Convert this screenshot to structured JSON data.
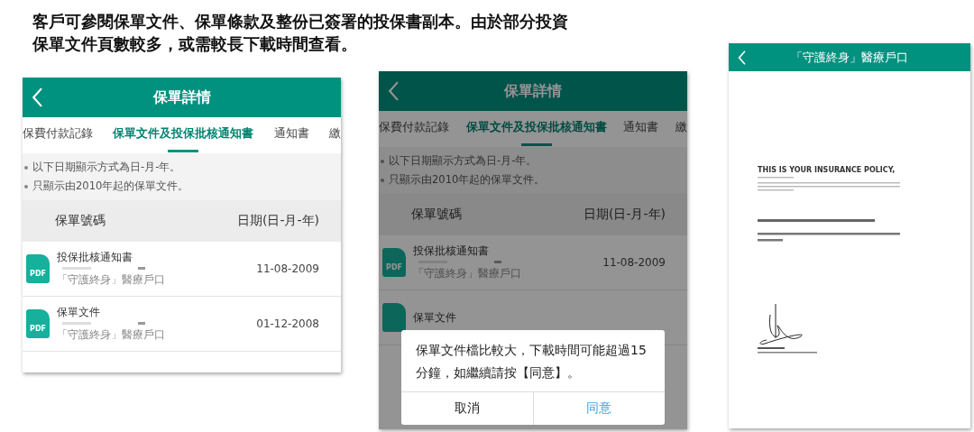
{
  "caption": [
    "客戶可參閱保單文件、保單條款及整份已簽署的投保書副本。由於部分投資",
    "保單文件頁數較多，或需較長下載時間查看。"
  ],
  "screens": [
    {
      "kind": "list",
      "dimmed": false,
      "title": "保單詳情",
      "tabs": [
        {
          "label": "保費付款記錄",
          "selected": false
        },
        {
          "label": "保單文件及投保批核通知書",
          "selected": true
        },
        {
          "label": "通知書",
          "selected": false
        },
        {
          "label": "繳",
          "selected": false
        }
      ],
      "notes": [
        "以下日期顯示方式為日-月-年。",
        "只顯示由2010年起的保單文件。"
      ],
      "columns": [
        "保單號碼",
        "日期(日-月-年)"
      ],
      "rows": [
        {
          "icon": "PDF",
          "title": "投保批核通知書",
          "subtitle": "「守護終身」醫療戶口",
          "date": "11-08-2009"
        },
        {
          "icon": "PDF",
          "title": "保單文件",
          "subtitle": "「守護終身」醫療戶口",
          "date": "01-12-2008"
        }
      ]
    },
    {
      "kind": "list",
      "dimmed": true,
      "title": "保單詳情",
      "tabs": [
        {
          "label": "保費付款記錄",
          "selected": false
        },
        {
          "label": "保單文件及投保批核通知書",
          "selected": true
        },
        {
          "label": "通知書",
          "selected": false
        },
        {
          "label": "繳",
          "selected": false
        }
      ],
      "notes": [
        "以下日期顯示方式為日-月-年。",
        "只顯示由2010年起的保單文件。"
      ],
      "columns": [
        "保單號碼",
        "日期(日-月-年)"
      ],
      "rows": [
        {
          "icon": "PDF",
          "title": "投保批核通知書",
          "subtitle": "「守護終身」醫療戶口",
          "date": "11-08-2009"
        },
        {
          "title": "保單文件"
        }
      ],
      "dialog": {
        "message": "保單文件檔比較大，下載時間可能超過15分鐘，如繼續請按【同意】。",
        "buttons": [
          {
            "label": "取消",
            "kind": "cancel"
          },
          {
            "label": "同意",
            "kind": "confirm"
          }
        ]
      }
    },
    {
      "kind": "document",
      "title": "「守護終身」醫療戶口",
      "heading": "THIS IS YOUR INSURANCE POLICY,"
    }
  ]
}
